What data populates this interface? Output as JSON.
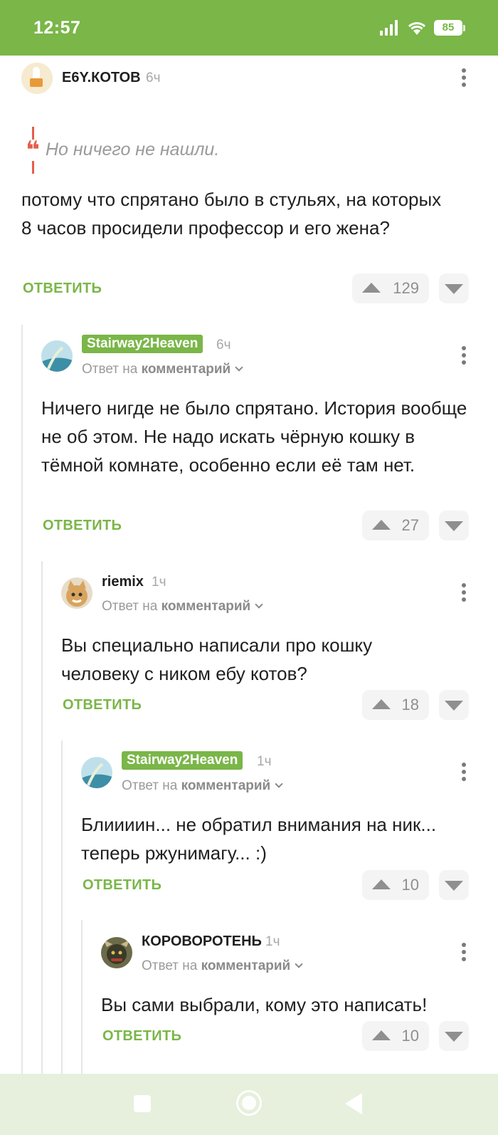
{
  "status_bar": {
    "time": "12:57",
    "battery": "85"
  },
  "comments": [
    {
      "author": "Е6Y.КОТОВ",
      "time": "6ч",
      "quote": "Но ничего не нашли.",
      "text": "потому что спрятано было в стульях, на которых 8 часов просидели профессор и его жена?",
      "reply_label": "ОТВЕТИТЬ",
      "votes": "129"
    },
    {
      "author": "Stairway2Heaven",
      "time": "6ч",
      "reply_to_prefix": "Ответ на",
      "reply_to_target": "комментарий",
      "text": "Ничего нигде не было спрятано. История вообще не об этом. Не надо искать чёрную кошку в тёмной комнате, особенно если её там нет.",
      "reply_label": "ОТВЕТИТЬ",
      "votes": "27"
    },
    {
      "author": "riemix",
      "time": "1ч",
      "reply_to_prefix": "Ответ на",
      "reply_to_target": "комментарий",
      "text": "Вы специально написали про кошку человеку с ником ебу котов?",
      "reply_label": "ОТВЕТИТЬ",
      "votes": "18"
    },
    {
      "author": "Stairway2Heaven",
      "time": "1ч",
      "reply_to_prefix": "Ответ на",
      "reply_to_target": "комментарий",
      "text": "Блиииин... не обратил внимания на ник... теперь ржунимагу... :)",
      "reply_label": "ОТВЕТИТЬ",
      "votes": "10"
    },
    {
      "author": "КОРОВОРОТЕНЬ",
      "time": "1ч",
      "reply_to_prefix": "Ответ на",
      "reply_to_target": "комментарий",
      "text": "Вы сами выбрали, кому это написать!",
      "reply_label": "ОТВЕТИТЬ",
      "votes": "10"
    }
  ],
  "icons": {
    "accent_color": "#7ab648",
    "quote_color": "#e55e4c"
  }
}
